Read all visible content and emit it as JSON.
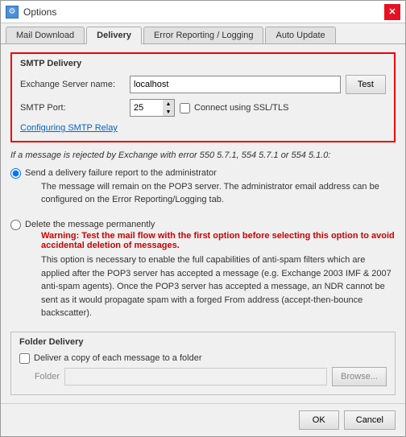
{
  "window": {
    "title": "Options",
    "icon": "gear-icon"
  },
  "tabs": [
    {
      "id": "mail-download",
      "label": "Mail Download",
      "active": false
    },
    {
      "id": "delivery",
      "label": "Delivery",
      "active": true
    },
    {
      "id": "error-reporting",
      "label": "Error Reporting / Logging",
      "active": false
    },
    {
      "id": "auto-update",
      "label": "Auto Update",
      "active": false
    }
  ],
  "smtp_delivery": {
    "group_label": "SMTP Delivery",
    "exchange_label": "Exchange Server name:",
    "exchange_value": "localhost",
    "test_button": "Test",
    "smtp_port_label": "SMTP Port:",
    "smtp_port_value": "25",
    "ssl_label": "Connect using SSL/TLS",
    "ssl_checked": false,
    "smtp_relay_link": "Configuring SMTP Relay"
  },
  "rejection_note": "If a message is rejected by Exchange with error 550 5.7.1, 554 5.7.1 or 554 5.1.0:",
  "radio_options": [
    {
      "id": "send-failure",
      "label": "Send a delivery failure report to the administrator",
      "checked": true,
      "description": "The message will remain on the POP3 server. The administrator email address can be configured on the Error Reporting/Logging tab."
    },
    {
      "id": "delete-permanently",
      "label": "Delete the message permanently",
      "checked": false,
      "warning": "Warning: Test the mail flow with the first option before selecting this option to avoid accidental deletion of messages.",
      "description": "This option is necessary to enable the full capabilities of anti-spam filters which are applied after the POP3 server has accepted a message (e.g. Exchange 2003 IMF & 2007 anti-spam agents). Once the POP3 server has accepted a message, an NDR cannot be sent as it would propagate spam with a forged From address (accept-then-bounce backscatter)."
    }
  ],
  "folder_delivery": {
    "group_label": "Folder Delivery",
    "deliver_copy_label": "Deliver a copy of each message to a folder",
    "deliver_copy_checked": false,
    "folder_label": "Folder",
    "folder_value": "",
    "browse_button": "Browse..."
  },
  "footer": {
    "ok_label": "OK",
    "cancel_label": "Cancel"
  }
}
